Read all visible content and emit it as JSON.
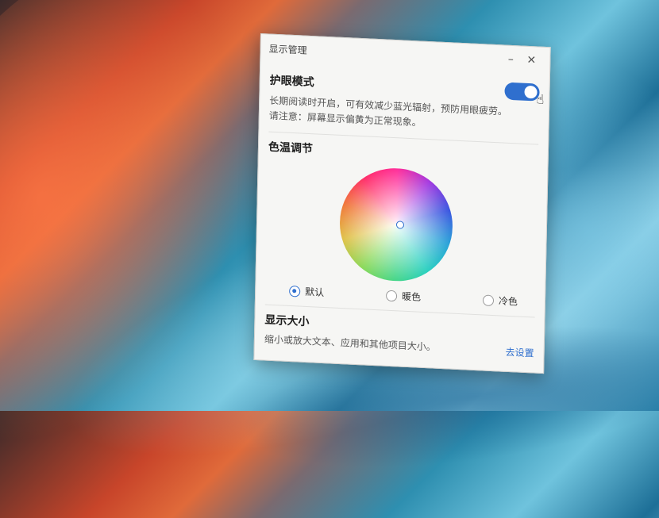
{
  "window": {
    "title": "显示管理",
    "minimize_glyph": "–",
    "close_glyph": "✕"
  },
  "eye_care": {
    "title": "护眼模式",
    "enabled": true,
    "desc_line1": "长期阅读时开启，可有效减少蓝光辐射，预防用眼疲劳。",
    "desc_line2": "请注意：屏幕显示偏黄为正常现象。"
  },
  "color_temp": {
    "title": "色温调节",
    "options": [
      {
        "label": "默认",
        "selected": true
      },
      {
        "label": "暖色",
        "selected": false
      },
      {
        "label": "冷色",
        "selected": false
      }
    ]
  },
  "display_size": {
    "title": "显示大小",
    "desc": "缩小或放大文本、应用和其他项目大小。",
    "link": "去设置"
  },
  "colors": {
    "accent": "#2f6fce",
    "window_bg": "#f6f6f4"
  },
  "icons": {
    "cursor": "hand-pointer-icon"
  }
}
